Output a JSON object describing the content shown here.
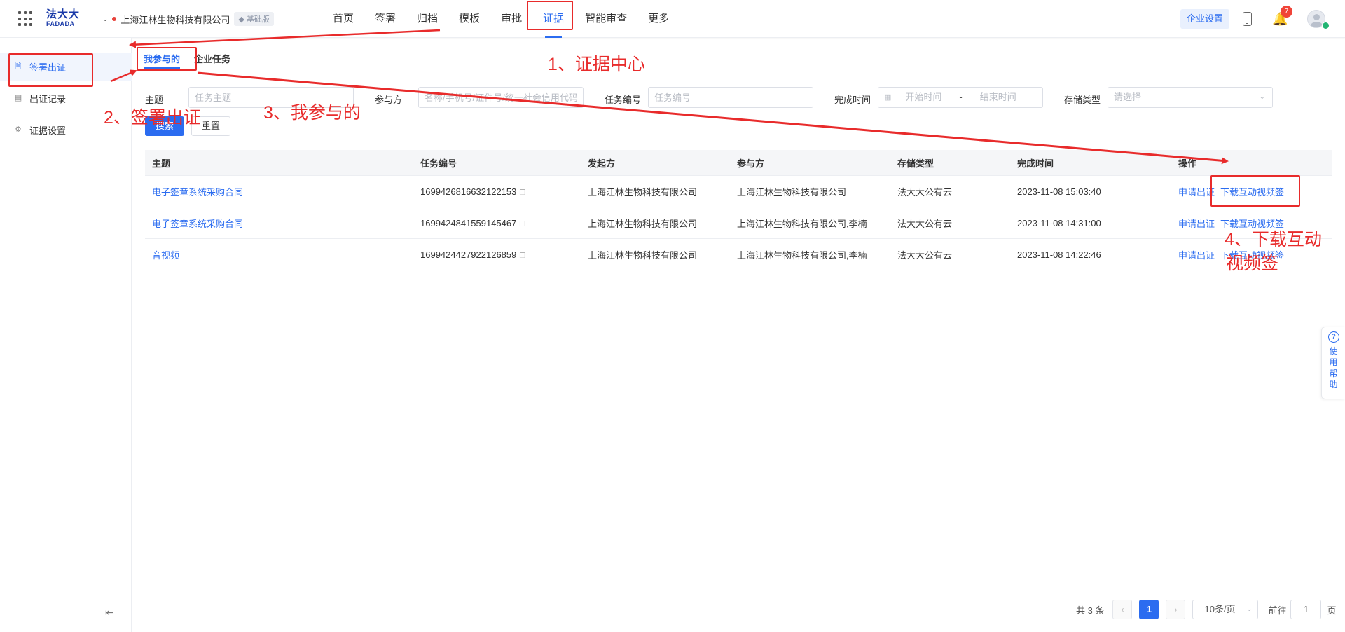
{
  "header": {
    "logo_cn": "法大大",
    "logo_en": "FADADA",
    "company": "上海江林生物科技有限公司",
    "plan_badge": "基础版",
    "nav": [
      {
        "label": "首页",
        "active": false
      },
      {
        "label": "签署",
        "active": false
      },
      {
        "label": "归档",
        "active": false
      },
      {
        "label": "模板",
        "active": false
      },
      {
        "label": "审批",
        "active": false
      },
      {
        "label": "证据",
        "active": true
      },
      {
        "label": "智能审查",
        "active": false
      },
      {
        "label": "更多",
        "active": false
      }
    ],
    "enterprise_settings": "企业设置",
    "notification_count": "7"
  },
  "sidebar": {
    "items": [
      {
        "label": "签署出证",
        "icon": "document-icon",
        "active": true
      },
      {
        "label": "出证记录",
        "icon": "record-icon",
        "active": false
      },
      {
        "label": "证据设置",
        "icon": "gear-icon",
        "active": false
      }
    ]
  },
  "tabs": [
    {
      "label": "我参与的",
      "active": true
    },
    {
      "label": "企业任务",
      "active": false
    }
  ],
  "filters": {
    "subject_label": "主题",
    "subject_placeholder": "任务主题",
    "participant_label": "参与方",
    "participant_placeholder": "名称/手机号/证件号/统一社会信用代码",
    "task_no_label": "任务编号",
    "task_no_placeholder": "任务编号",
    "finish_time_label": "完成时间",
    "start_placeholder": "开始时间",
    "range_sep": "-",
    "end_placeholder": "结束时间",
    "storage_label": "存储类型",
    "storage_placeholder": "请选择",
    "search_btn": "搜索",
    "reset_btn": "重置"
  },
  "table": {
    "columns": [
      "主题",
      "任务编号",
      "发起方",
      "参与方",
      "存储类型",
      "完成时间",
      "操作"
    ],
    "rows": [
      {
        "subject": "电子签章系统采购合同",
        "task_no": "1699426816632122153",
        "initiator": "上海江林生物科技有限公司",
        "participant": "上海江林生物科技有限公司",
        "storage": "法大大公有云",
        "time": "2023-11-08 15:03:40",
        "op1": "申请出证",
        "op2": "下载互动视频签"
      },
      {
        "subject": "电子签章系统采购合同",
        "task_no": "1699424841559145467",
        "initiator": "上海江林生物科技有限公司",
        "participant": "上海江林生物科技有限公司,李楠",
        "storage": "法大大公有云",
        "time": "2023-11-08 14:31:00",
        "op1": "申请出证",
        "op2": "下载互动视频签"
      },
      {
        "subject": "音视频",
        "task_no": "1699424427922126859",
        "initiator": "上海江林生物科技有限公司",
        "participant": "上海江林生物科技有限公司,李楠",
        "storage": "法大大公有云",
        "time": "2023-11-08 14:22:46",
        "op1": "申请出证",
        "op2": "下载互动视频签"
      }
    ]
  },
  "pagination": {
    "total": "共 3 条",
    "current": "1",
    "page_size": "10条/页",
    "goto_label": "前往",
    "goto_value": "1",
    "page_suffix": "页"
  },
  "help": {
    "label": "使用帮助"
  },
  "annotations": {
    "step1": "1、证据中心",
    "step2": "2、签署出证",
    "step3": "3、我参与的",
    "step4_line1": "4、下载互动",
    "step4_line2": "视频签",
    "color": "#e82b2b"
  }
}
